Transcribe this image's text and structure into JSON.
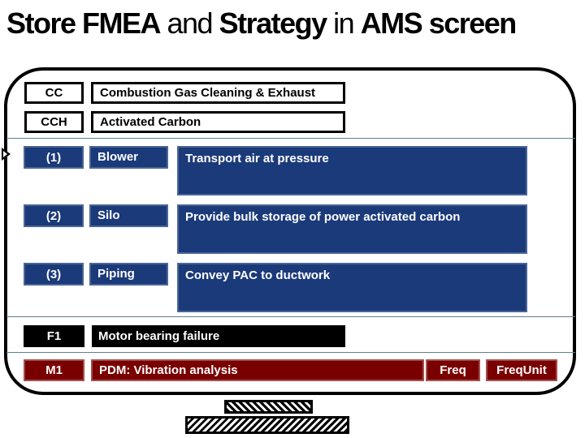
{
  "title": {
    "part1": "Store FMEA",
    "part2": " and ",
    "part3": "Strategy",
    "part4": " in ",
    "part5": "AMS screen"
  },
  "system": {
    "code": "CC",
    "name": "Combustion Gas Cleaning & Exhaust"
  },
  "subsystem": {
    "code": "CCH",
    "name": "Activated Carbon"
  },
  "components": [
    {
      "code": "(1)",
      "name": "Blower",
      "function": "Transport air at pressure",
      "selected": true
    },
    {
      "code": "(2)",
      "name": "Silo",
      "function": "Provide bulk storage of power activated carbon",
      "selected": false
    },
    {
      "code": "(3)",
      "name": "Piping",
      "function": "Convey PAC to ductwork",
      "selected": false
    }
  ],
  "failure": {
    "code": "F1",
    "description": "Motor bearing failure"
  },
  "maintenance": {
    "code": "M1",
    "strategy": "PDM: Vibration analysis",
    "freq_label": "Freq",
    "freq_unit_label": "FreqUnit"
  },
  "icons": {
    "selection_pointer": "triangle-right-icon"
  },
  "colors": {
    "component_bg": "#1b3a7a",
    "failure_bg": "#000000",
    "maintenance_bg": "#7a0000"
  }
}
